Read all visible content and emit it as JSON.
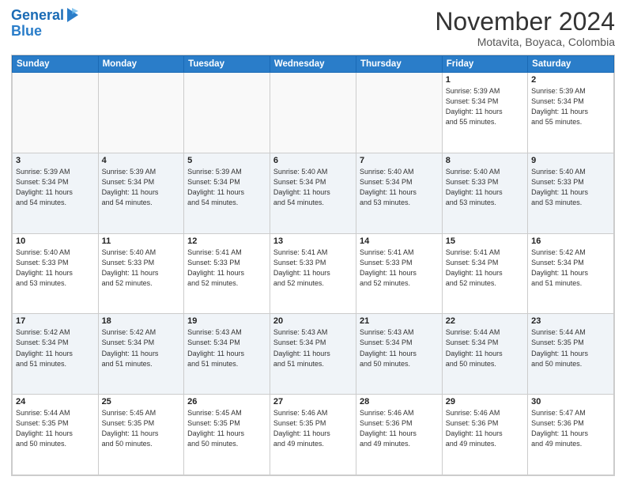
{
  "header": {
    "logo_line1": "General",
    "logo_line2": "Blue",
    "month": "November 2024",
    "location": "Motavita, Boyaca, Colombia"
  },
  "days_of_week": [
    "Sunday",
    "Monday",
    "Tuesday",
    "Wednesday",
    "Thursday",
    "Friday",
    "Saturday"
  ],
  "weeks": [
    [
      {
        "day": "",
        "info": ""
      },
      {
        "day": "",
        "info": ""
      },
      {
        "day": "",
        "info": ""
      },
      {
        "day": "",
        "info": ""
      },
      {
        "day": "",
        "info": ""
      },
      {
        "day": "1",
        "info": "Sunrise: 5:39 AM\nSunset: 5:34 PM\nDaylight: 11 hours\nand 55 minutes."
      },
      {
        "day": "2",
        "info": "Sunrise: 5:39 AM\nSunset: 5:34 PM\nDaylight: 11 hours\nand 55 minutes."
      }
    ],
    [
      {
        "day": "3",
        "info": "Sunrise: 5:39 AM\nSunset: 5:34 PM\nDaylight: 11 hours\nand 54 minutes."
      },
      {
        "day": "4",
        "info": "Sunrise: 5:39 AM\nSunset: 5:34 PM\nDaylight: 11 hours\nand 54 minutes."
      },
      {
        "day": "5",
        "info": "Sunrise: 5:39 AM\nSunset: 5:34 PM\nDaylight: 11 hours\nand 54 minutes."
      },
      {
        "day": "6",
        "info": "Sunrise: 5:40 AM\nSunset: 5:34 PM\nDaylight: 11 hours\nand 54 minutes."
      },
      {
        "day": "7",
        "info": "Sunrise: 5:40 AM\nSunset: 5:34 PM\nDaylight: 11 hours\nand 53 minutes."
      },
      {
        "day": "8",
        "info": "Sunrise: 5:40 AM\nSunset: 5:33 PM\nDaylight: 11 hours\nand 53 minutes."
      },
      {
        "day": "9",
        "info": "Sunrise: 5:40 AM\nSunset: 5:33 PM\nDaylight: 11 hours\nand 53 minutes."
      }
    ],
    [
      {
        "day": "10",
        "info": "Sunrise: 5:40 AM\nSunset: 5:33 PM\nDaylight: 11 hours\nand 53 minutes."
      },
      {
        "day": "11",
        "info": "Sunrise: 5:40 AM\nSunset: 5:33 PM\nDaylight: 11 hours\nand 52 minutes."
      },
      {
        "day": "12",
        "info": "Sunrise: 5:41 AM\nSunset: 5:33 PM\nDaylight: 11 hours\nand 52 minutes."
      },
      {
        "day": "13",
        "info": "Sunrise: 5:41 AM\nSunset: 5:33 PM\nDaylight: 11 hours\nand 52 minutes."
      },
      {
        "day": "14",
        "info": "Sunrise: 5:41 AM\nSunset: 5:33 PM\nDaylight: 11 hours\nand 52 minutes."
      },
      {
        "day": "15",
        "info": "Sunrise: 5:41 AM\nSunset: 5:34 PM\nDaylight: 11 hours\nand 52 minutes."
      },
      {
        "day": "16",
        "info": "Sunrise: 5:42 AM\nSunset: 5:34 PM\nDaylight: 11 hours\nand 51 minutes."
      }
    ],
    [
      {
        "day": "17",
        "info": "Sunrise: 5:42 AM\nSunset: 5:34 PM\nDaylight: 11 hours\nand 51 minutes."
      },
      {
        "day": "18",
        "info": "Sunrise: 5:42 AM\nSunset: 5:34 PM\nDaylight: 11 hours\nand 51 minutes."
      },
      {
        "day": "19",
        "info": "Sunrise: 5:43 AM\nSunset: 5:34 PM\nDaylight: 11 hours\nand 51 minutes."
      },
      {
        "day": "20",
        "info": "Sunrise: 5:43 AM\nSunset: 5:34 PM\nDaylight: 11 hours\nand 51 minutes."
      },
      {
        "day": "21",
        "info": "Sunrise: 5:43 AM\nSunset: 5:34 PM\nDaylight: 11 hours\nand 50 minutes."
      },
      {
        "day": "22",
        "info": "Sunrise: 5:44 AM\nSunset: 5:34 PM\nDaylight: 11 hours\nand 50 minutes."
      },
      {
        "day": "23",
        "info": "Sunrise: 5:44 AM\nSunset: 5:35 PM\nDaylight: 11 hours\nand 50 minutes."
      }
    ],
    [
      {
        "day": "24",
        "info": "Sunrise: 5:44 AM\nSunset: 5:35 PM\nDaylight: 11 hours\nand 50 minutes."
      },
      {
        "day": "25",
        "info": "Sunrise: 5:45 AM\nSunset: 5:35 PM\nDaylight: 11 hours\nand 50 minutes."
      },
      {
        "day": "26",
        "info": "Sunrise: 5:45 AM\nSunset: 5:35 PM\nDaylight: 11 hours\nand 50 minutes."
      },
      {
        "day": "27",
        "info": "Sunrise: 5:46 AM\nSunset: 5:35 PM\nDaylight: 11 hours\nand 49 minutes."
      },
      {
        "day": "28",
        "info": "Sunrise: 5:46 AM\nSunset: 5:36 PM\nDaylight: 11 hours\nand 49 minutes."
      },
      {
        "day": "29",
        "info": "Sunrise: 5:46 AM\nSunset: 5:36 PM\nDaylight: 11 hours\nand 49 minutes."
      },
      {
        "day": "30",
        "info": "Sunrise: 5:47 AM\nSunset: 5:36 PM\nDaylight: 11 hours\nand 49 minutes."
      }
    ]
  ]
}
